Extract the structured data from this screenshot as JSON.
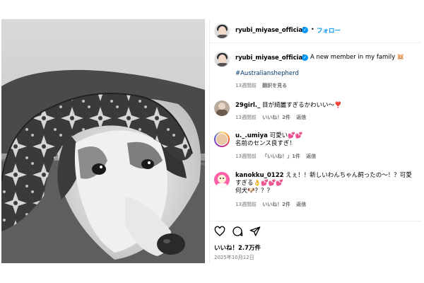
{
  "post": {
    "username": "ryubi_miyase_official",
    "follow_label": "フォロー",
    "dot": "•",
    "caption_text": "A new member in my family 🐹",
    "hashtag": "#Australianshepherd",
    "caption_time": "13週間前",
    "translate_label": "翻訳を見る"
  },
  "comments": [
    {
      "username": "29girl._",
      "text": "目が綺麗すぎるかわいい〜❣️",
      "time": "13週間前",
      "like_label": "いいね！2件",
      "reply_label": "返信"
    },
    {
      "username": "u._.umiya",
      "text_line1": "可愛い💕💕",
      "text_line2": "名前のセンス良すぎ！",
      "time": "13週間前",
      "like_label": "「いいね！」1件",
      "reply_label": "返信"
    },
    {
      "username": "kanokku_0122",
      "text_line1": "えぇ！！新しいわんちゃん飼ったの〜！？可愛",
      "text_line2": "すぎる👌💕💕💕",
      "text_line3": "何犬🐶？？？",
      "time": "13週間前",
      "like_label": "いいね！2件",
      "reply_label": "返信"
    }
  ],
  "footer": {
    "likes": "いいね！2.7万件",
    "date": "2025年10月12日"
  },
  "colors": {
    "accent": "#0095f6",
    "muted": "#737373",
    "hashtag": "#00376b"
  },
  "icons": {
    "like": "heart-outline-icon",
    "comment": "comment-bubble-icon",
    "share": "paper-plane-icon",
    "verified": "verified-badge-icon"
  }
}
